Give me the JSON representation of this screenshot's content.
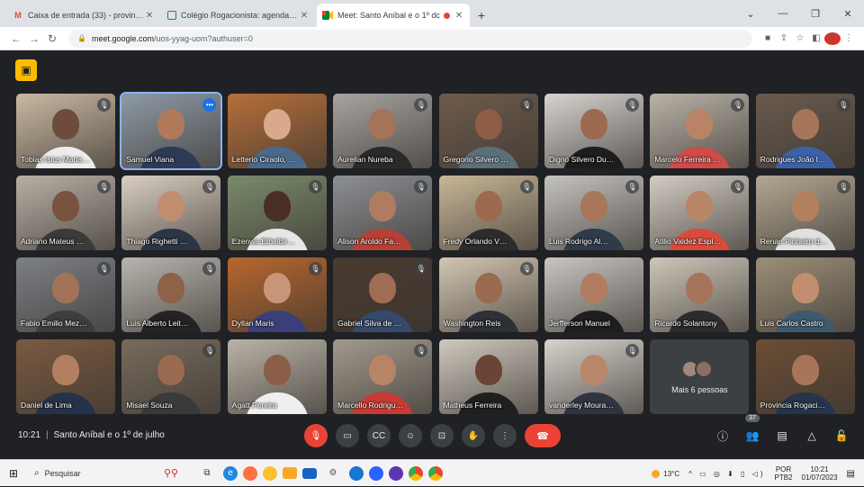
{
  "browser": {
    "tabs": [
      {
        "favicon": "gmail-icon",
        "title": "Caixa de entrada (33) - provinc…",
        "active": false
      },
      {
        "favicon": "classroom-icon",
        "title": "Colégio Rogacionista: agenda - …",
        "active": false
      },
      {
        "favicon": "meet-icon",
        "title": "Meet: Santo Aníbal e o 1º dc",
        "active": true
      }
    ],
    "url_host": "meet.google.com",
    "url_path": "/uos-yyag-uom?authuser=0"
  },
  "meet": {
    "meeting_time": "10:21",
    "meeting_title": "Santo Aníbal e o 1º de julho",
    "more_people_label": "Mais 6 pessoas",
    "participant_count": "37",
    "participants": [
      {
        "name": "Tobias Isius Maria…",
        "mic": "muted",
        "skin": "#6d4c3b",
        "shirt": "#ececec",
        "bg": "#c9b9a3"
      },
      {
        "name": "Samuel Viana",
        "mic": "speaking",
        "skin": "#b07a5a",
        "shirt": "#2e3a55",
        "bg": "#8e9aa6"
      },
      {
        "name": "Letterio Ciraolo, …",
        "mic": "none",
        "skin": "#d8a98a",
        "shirt": "#4a6a8c",
        "bg": "#b56f3a"
      },
      {
        "name": "Aurelian Nureba",
        "mic": "muted",
        "skin": "#a3735a",
        "shirt": "#2a2a2a",
        "bg": "#a7a39e"
      },
      {
        "name": "Gregorio Silvero …",
        "mic": "muted",
        "skin": "#8d5d45",
        "shirt": "#5b6f79",
        "bg": "#6f5b4b"
      },
      {
        "name": "Digno Silvero Du…",
        "mic": "muted",
        "skin": "#9b6a50",
        "shirt": "#1d1d1d",
        "bg": "#d7d4cf"
      },
      {
        "name": "Marcelo Ferreira …",
        "mic": "muted",
        "skin": "#b98466",
        "shirt": "#d04a48",
        "bg": "#b9b2a8"
      },
      {
        "name": "Rodrigues João I…",
        "mic": "muted",
        "skin": "#a6765b",
        "shirt": "#3b62a8",
        "bg": "#6a5a4e"
      },
      {
        "name": "Adriano Mateus …",
        "mic": "muted",
        "skin": "#7a5240",
        "shirt": "#3a3a3a",
        "bg": "#b8b0a6"
      },
      {
        "name": "Thiago Righetti …",
        "mic": "muted",
        "skin": "#c08d6e",
        "shirt": "#2b3543",
        "bg": "#d9cfc3"
      },
      {
        "name": "Ezenwa Ethelbir…",
        "mic": "muted",
        "skin": "#4b2e23",
        "shirt": "#e6e6e6",
        "bg": "#7a8a6c"
      },
      {
        "name": "Alison Aroldo Fa…",
        "mic": "muted",
        "skin": "#b07c5f",
        "shirt": "#b54135",
        "bg": "#8c8f94"
      },
      {
        "name": "Fredy Orlando V…",
        "mic": "muted",
        "skin": "#9d6a4e",
        "shirt": "#2c2c2c",
        "bg": "#c8b797"
      },
      {
        "name": "Luis Rodrigo Al…",
        "mic": "muted",
        "skin": "#a87658",
        "shirt": "#303b4a",
        "bg": "#c5c3c0"
      },
      {
        "name": "Atilio Valdez Espi…",
        "mic": "muted",
        "skin": "#b98567",
        "shirt": "#d94a3b",
        "bg": "#d2ccc3"
      },
      {
        "name": "Renan Pinheiro d…",
        "mic": "muted",
        "skin": "#b3805f",
        "shirt": "#e0e0e0",
        "bg": "#b2a793"
      },
      {
        "name": "Fabio Emilio Mez…",
        "mic": "muted",
        "skin": "#a27359",
        "shirt": "#3d3d3d",
        "bg": "#7d8087"
      },
      {
        "name": "Luis Alberto Leit…",
        "mic": "muted",
        "skin": "#8e6149",
        "shirt": "#232323",
        "bg": "#b8b4ae"
      },
      {
        "name": "Dyllan Maris",
        "mic": "muted",
        "skin": "#c9957a",
        "shirt": "#3a3f7a",
        "bg": "#b7672e"
      },
      {
        "name": "Gabriel Silva de …",
        "mic": "muted",
        "skin": "#a06d54",
        "shirt": "#354a6a",
        "bg": "#4a3a30"
      },
      {
        "name": "Washington Reis",
        "mic": "muted",
        "skin": "#9b6b4f",
        "shirt": "#2e3038",
        "bg": "#d3c6b2"
      },
      {
        "name": "Jerfferson Manuel",
        "mic": "none",
        "skin": "#b17c60",
        "shirt": "#1e1e1e",
        "bg": "#c9c6c2"
      },
      {
        "name": "Ricardo Solantony",
        "mic": "none",
        "skin": "#a7735a",
        "shirt": "#2c2c2c",
        "bg": "#cdc6ba"
      },
      {
        "name": "Luis Carlos Castro",
        "mic": "none",
        "skin": "#c38e6f",
        "shirt": "#3e5a6e",
        "bg": "#9c8f78"
      },
      {
        "name": "Daniel de Lima",
        "mic": "none",
        "skin": "#b27f62",
        "shirt": "#26324a",
        "bg": "#7b5a40"
      },
      {
        "name": "Misael Souza",
        "mic": "muted",
        "skin": "#9a6a51",
        "shirt": "#3a3a3a",
        "bg": "#776b5d"
      },
      {
        "name": "Agatt Pereira",
        "mic": "none",
        "skin": "#8b5e47",
        "shirt": "#efefef",
        "bg": "#b9b3a8"
      },
      {
        "name": "Marcello Rodrigu…",
        "mic": "muted",
        "skin": "#b88466",
        "shirt": "#c93a32",
        "bg": "#a29a8e"
      },
      {
        "name": "Matheus Ferreira",
        "mic": "none",
        "skin": "#6a4435",
        "shirt": "#1f1f1f",
        "bg": "#cfc9bf"
      },
      {
        "name": "vanderley Moura…",
        "mic": "muted",
        "skin": "#b9876b",
        "shirt": "#2f3440",
        "bg": "#d6d2cc"
      },
      {
        "name": "",
        "mic": "none",
        "skin": "",
        "shirt": "",
        "bg": ""
      },
      {
        "name": "Provincia Rogaci…",
        "mic": "none",
        "skin": "#a8755b",
        "shirt": "#26354c",
        "bg": "#6b4e35"
      }
    ]
  },
  "taskbar": {
    "search_placeholder": "Pesquisar",
    "temperature": "13°C",
    "lang_top": "POR",
    "lang_bottom": "PTB2",
    "time": "10:21",
    "date": "01/07/2023"
  },
  "colors": {
    "meet_bg": "#202124",
    "end_call": "#ea4335",
    "mic_muted": "#ea4335",
    "speaking_outline": "#8ab4f8",
    "raise_badge": "#fbbc04"
  }
}
